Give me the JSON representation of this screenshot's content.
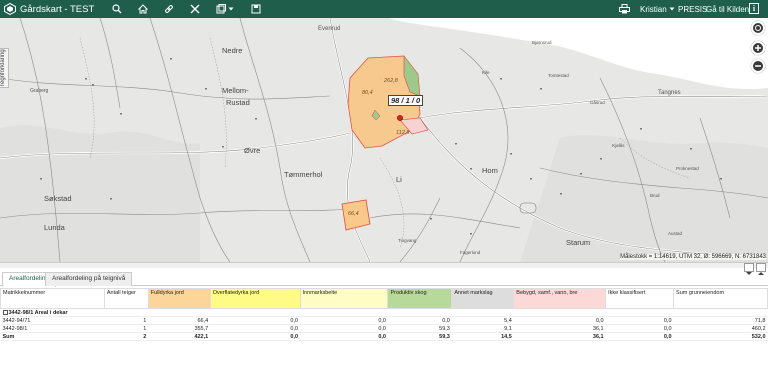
{
  "header": {
    "title": "Gårdskart - TEST",
    "user": "Kristian",
    "presis": "PRESIS",
    "gaa_til_kilden": "Gå til Kilden",
    "icons": [
      "search-icon",
      "home-icon",
      "link-icon",
      "tools-icon",
      "layers-icon",
      "save-icon",
      "print-icon",
      "info-icon"
    ]
  },
  "map": {
    "side_tab": "Tegnforklaring",
    "scale_text": "Målestokk = 1:14619, UTM 32, Ø: 596669, N: 6731843",
    "place_names": [
      "Nedre",
      "Mellom-",
      "Rustad",
      "Øvre",
      "Tømmerhol",
      "Søkstad",
      "Lunda",
      "Li",
      "Hom",
      "Starum",
      "Evenrud",
      "Tangnes",
      "Graberg"
    ],
    "small_names": [
      "Kile",
      "Gåsrud",
      "Proknestad",
      "Brud",
      "Austad",
      "Bjørnsrud",
      "Tingvang",
      "Tomtestad",
      "Kjølås",
      "Fagerlund"
    ],
    "parcel": {
      "id": "98 / 1 / 0",
      "areas": [
        "262,8",
        "80,4",
        "112,8",
        "66,4"
      ]
    },
    "controls": [
      "close-icon",
      "zoom-in-icon",
      "zoom-out-icon"
    ]
  },
  "tabs": [
    "Arealfordeling",
    "Arealfordeling på teignivå"
  ],
  "table": {
    "headers": [
      {
        "label": "Matrikkelnummer",
        "color": "#ffffff"
      },
      {
        "label": "Antall teiger",
        "color": "#ffffff"
      },
      {
        "label": "Fulldyrka jord",
        "color": "#fbd59a"
      },
      {
        "label": "Overflatedyrka jord",
        "color": "#fffb84"
      },
      {
        "label": "Innmarksbeite",
        "color": "#fffdc4"
      },
      {
        "label": "Produktiv skog",
        "color": "#b7d99a"
      },
      {
        "label": "Annet markslag",
        "color": "#dddddd"
      },
      {
        "label": "Bebygd, samf., vann, bre",
        "color": "#fcd9d6"
      },
      {
        "label": "Ikke klassifisert",
        "color": "#ffffff"
      },
      {
        "label": "Sum grunneiendom",
        "color": "#ffffff"
      }
    ],
    "group_row": "3442-98/1 Areal i dekar",
    "rows": [
      [
        "3442-94/71",
        "1",
        "66,4",
        "0,0",
        "0,0",
        "0,0",
        "5,4",
        "0,0",
        "0,0",
        "71,8"
      ],
      [
        "3442-98/1",
        "1",
        "355,7",
        "0,0",
        "0,0",
        "59,3",
        "9,1",
        "36,1",
        "0,0",
        "460,2"
      ]
    ],
    "sum_row": [
      "Sum",
      "2",
      "422,1",
      "0,0",
      "0,0",
      "59,3",
      "14,5",
      "36,1",
      "0,0",
      "532,0"
    ]
  }
}
